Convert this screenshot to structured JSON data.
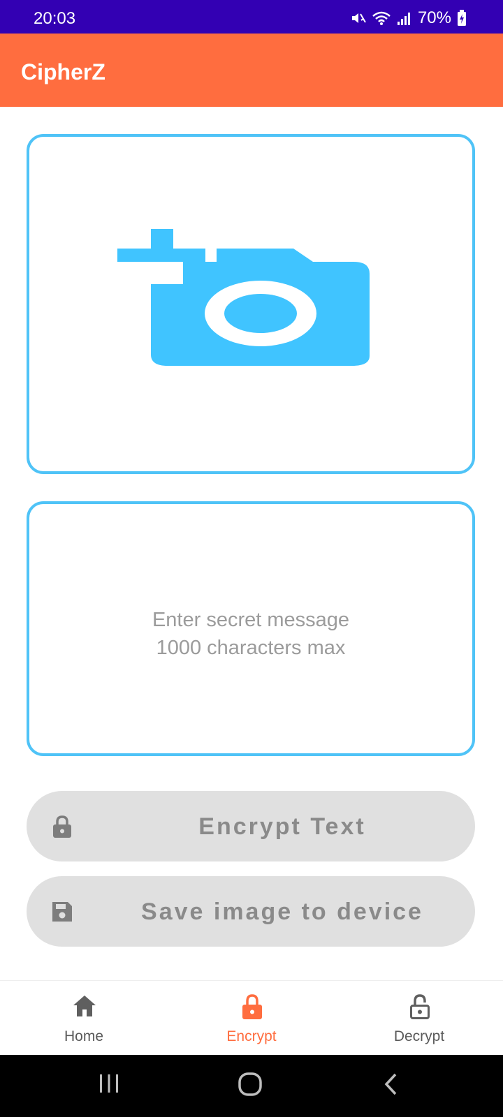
{
  "status_bar": {
    "time": "20:03",
    "battery": "70%",
    "icons": [
      "mute-icon",
      "wifi-icon",
      "signal-icon",
      "battery-charging-icon"
    ]
  },
  "app_bar": {
    "title": "CipherZ"
  },
  "image_picker": {
    "icon": "add-photo-icon"
  },
  "message": {
    "placeholder_line1": "Enter secret message",
    "placeholder_line2": "1000 characters max"
  },
  "buttons": {
    "encrypt_label": "Encrypt Text",
    "encrypt_icon": "lock-icon",
    "save_label": "Save image to device",
    "save_icon": "save-icon"
  },
  "bottom_nav": {
    "items": [
      {
        "label": "Home",
        "icon": "home-icon",
        "active": false
      },
      {
        "label": "Encrypt",
        "icon": "lock-icon",
        "active": true
      },
      {
        "label": "Decrypt",
        "icon": "lock-open-icon",
        "active": false
      }
    ]
  },
  "colors": {
    "status_bar": "#3300b3",
    "app_bar": "#ff6d3f",
    "accent_blue": "#4fc3f7",
    "button_bg": "#e0e0e0",
    "nav_active": "#ff6d3f"
  },
  "system_nav": {
    "buttons": [
      "recents-icon",
      "home-circle-icon",
      "back-icon"
    ]
  }
}
